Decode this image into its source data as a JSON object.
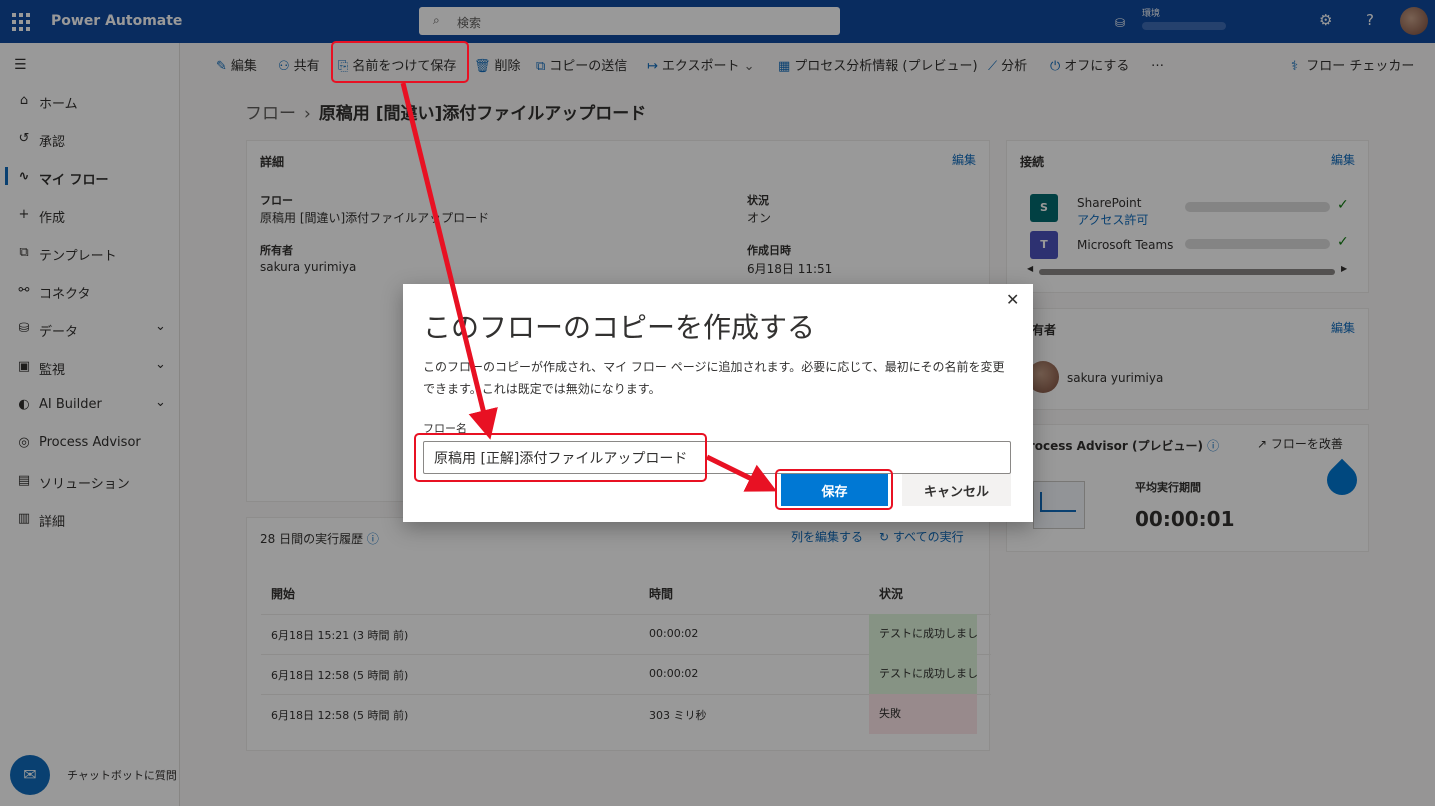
{
  "app": {
    "name": "Power Automate"
  },
  "search": {
    "placeholder": "検索"
  },
  "env": {
    "label": "環境"
  },
  "sidebar": {
    "items": [
      {
        "label": "ホーム",
        "icon": "home-icon",
        "glyph": "⌂"
      },
      {
        "label": "承認",
        "icon": "approvals-icon",
        "glyph": "↺"
      },
      {
        "label": "マイ フロー",
        "icon": "flow-icon",
        "glyph": "∿",
        "active": true
      },
      {
        "label": "作成",
        "icon": "plus-icon",
        "glyph": "+"
      },
      {
        "label": "テンプレート",
        "icon": "template-icon",
        "glyph": "⧉"
      },
      {
        "label": "コネクタ",
        "icon": "connector-icon",
        "glyph": "⚯"
      },
      {
        "label": "データ",
        "icon": "database-icon",
        "glyph": "⛁",
        "chevron": true
      },
      {
        "label": "監視",
        "icon": "monitor-icon",
        "glyph": "▣",
        "chevron": true
      },
      {
        "label": "AI Builder",
        "icon": "ai-builder-icon",
        "glyph": "◐",
        "chevron": true
      },
      {
        "label": "Process Advisor",
        "icon": "process-advisor-icon",
        "glyph": "◎"
      },
      {
        "label": "ソリューション",
        "icon": "solution-icon",
        "glyph": "▤"
      },
      {
        "label": "詳細",
        "icon": "book-icon",
        "glyph": "▥"
      }
    ],
    "chatbot": "チャットボットに質問"
  },
  "cmdbar": {
    "items": [
      {
        "label": "編集",
        "icon": "edit-icon",
        "glyph": "✎"
      },
      {
        "label": "共有",
        "icon": "share-icon",
        "glyph": "⚇"
      },
      {
        "label": "名前をつけて保存",
        "icon": "save-as-icon",
        "glyph": "⎘"
      },
      {
        "label": "削除",
        "icon": "delete-icon",
        "glyph": "🗑"
      },
      {
        "label": "コピーの送信",
        "icon": "copy-icon",
        "glyph": "⧉"
      },
      {
        "label": "エクスポート",
        "icon": "export-icon",
        "glyph": "↦",
        "chevron": true
      },
      {
        "label": "プロセス分析情報 (プレビュー)",
        "icon": "process-insights-icon",
        "glyph": "▦"
      },
      {
        "label": "分析",
        "icon": "analytics-icon",
        "glyph": "⟋"
      },
      {
        "label": "オフにする",
        "icon": "power-icon",
        "glyph": "⏻"
      },
      {
        "label": "…",
        "icon": "more-icon",
        "glyph": ""
      }
    ],
    "flow_checker": "フロー チェッカー"
  },
  "breadcrumb": {
    "root": "フロー",
    "current": "原稿用 [間違い]添付ファイルアップロード"
  },
  "details": {
    "title": "詳細",
    "edit": "編集",
    "flow_label": "フロー",
    "flow_value": "原稿用 [間違い]添付ファイルアップロード",
    "status_label": "状況",
    "status_value": "オン",
    "owner_label": "所有者",
    "owner_value": "sakura yurimiya",
    "created_label": "作成日時",
    "created_value": "6月18日 11:51"
  },
  "connections": {
    "title": "接続",
    "edit": "編集",
    "items": [
      {
        "name": "SharePoint",
        "sub": "アクセス許可",
        "color": "#036c70",
        "abbr": "S"
      },
      {
        "name": "Microsoft Teams",
        "sub": "",
        "color": "#4b53bc",
        "abbr": "T"
      }
    ]
  },
  "owners": {
    "title": "所有者",
    "edit": "編集",
    "name": "sakura yurimiya"
  },
  "process_advisor": {
    "title": "Process Advisor (プレビュー)",
    "improve": "フローを改善",
    "avg_label": "平均実行期間",
    "avg_value": "00:00:01"
  },
  "history": {
    "title": "28 日間の実行履歴",
    "edit_columns": "列を編集する",
    "all_runs": "すべての実行",
    "columns": [
      "開始",
      "時間",
      "状況"
    ],
    "rows": [
      {
        "start": "6月18日 15:21 (3 時間 前)",
        "duration": "00:00:02",
        "status": "テストに成功しました",
        "color": "#dff6dd"
      },
      {
        "start": "6月18日 12:58 (5 時間 前)",
        "duration": "00:00:02",
        "status": "テストに成功しました",
        "color": "#dff6dd"
      },
      {
        "start": "6月18日 12:58 (5 時間 前)",
        "duration": "303 ミリ秒",
        "status": "失敗",
        "color": "#fde7e9"
      }
    ]
  },
  "dialog": {
    "title": "このフローのコピーを作成する",
    "description": "このフローのコピーが作成され、マイ フロー ページに追加されます。必要に応じて、最初にその名前を変更できます。これは既定では無効になります。",
    "field_label": "フロー名",
    "field_value": "原稿用 [正解]添付ファイルアップロード",
    "save": "保存",
    "cancel": "キャンセル"
  }
}
